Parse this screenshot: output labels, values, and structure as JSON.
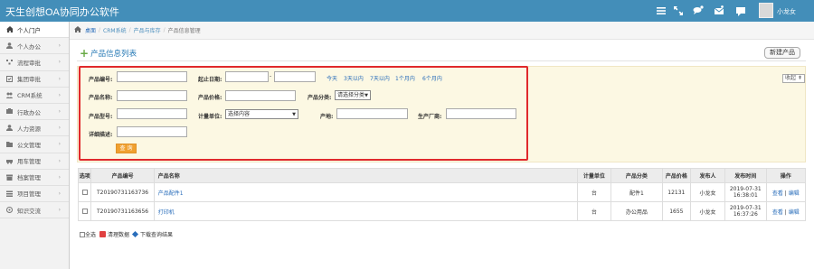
{
  "app": {
    "title": "天生创想OA协同办公软件",
    "user_name": "小龙女"
  },
  "colors": {
    "header": "#438eb9",
    "highlight_border": "#e0292c",
    "search_panel": "#fcf8e3",
    "search_button": "#f0a030"
  },
  "topbar_icons": [
    "menu-icon",
    "expand-icon",
    "chat-icon",
    "mail-icon",
    "message-icon"
  ],
  "sidebar": {
    "items": [
      {
        "label": "个人门户",
        "icon": "home-icon",
        "active": true
      },
      {
        "label": "个人办公",
        "icon": "user-icon"
      },
      {
        "label": "流程审批",
        "icon": "flow-icon"
      },
      {
        "label": "集团审批",
        "icon": "approval-icon"
      },
      {
        "label": "CRM系统",
        "icon": "crm-icon"
      },
      {
        "label": "行政办公",
        "icon": "office-icon"
      },
      {
        "label": "人力资源",
        "icon": "hr-icon"
      },
      {
        "label": "公文管理",
        "icon": "document-icon"
      },
      {
        "label": "用车管理",
        "icon": "car-icon"
      },
      {
        "label": "档案管理",
        "icon": "archive-icon"
      },
      {
        "label": "项目管理",
        "icon": "project-icon"
      },
      {
        "label": "知识交流",
        "icon": "knowledge-icon"
      }
    ],
    "arrow": "›"
  },
  "breadcrumb": [
    "桌面",
    "CRM系统",
    "产品与库存",
    "产品信息管理"
  ],
  "page": {
    "title": "产品信息列表",
    "new_button": "新建产品",
    "collapse": "收起 ⇞"
  },
  "search": {
    "code_label": "产品编号:",
    "date_label": "起止日期:",
    "date_sep": "-",
    "quick_dates": [
      "今天",
      "3天以内",
      "7天以内",
      "1个月内",
      "6个月内"
    ],
    "name_label": "产品名称:",
    "price_label": "产品价格:",
    "category_label": "产品分类:",
    "category_value": "请选择分类",
    "model_label": "产品型号:",
    "unit_label": "计量单位:",
    "unit_value": "选择内容",
    "origin_label": "产地:",
    "maker_label": "生产厂商:",
    "desc_label": "详细描述:",
    "search_button": "查 询"
  },
  "table": {
    "headers": [
      "选项",
      "产品编号",
      "产品名称",
      "计量单位",
      "产品分类",
      "产品价格",
      "发布人",
      "发布时间",
      "操作"
    ],
    "rows": [
      {
        "code": "T20190731163736",
        "name": "产品配件1",
        "unit": "台",
        "category": "配件1",
        "price": "12131",
        "publisher": "小龙女",
        "date": "2019-07-31",
        "time": "16:38:01",
        "view": "查看",
        "edit": "编辑"
      },
      {
        "code": "T20190731163656",
        "name": "打印机",
        "unit": "台",
        "category": "办公用品",
        "price": "1655",
        "publisher": "小龙女",
        "date": "2019-07-31",
        "time": "16:37:26",
        "view": "查看",
        "edit": "编辑"
      }
    ],
    "action_sep": "|"
  },
  "footer": {
    "select_all": "全选",
    "delete": "清理数据",
    "download": "下载查询结果"
  }
}
